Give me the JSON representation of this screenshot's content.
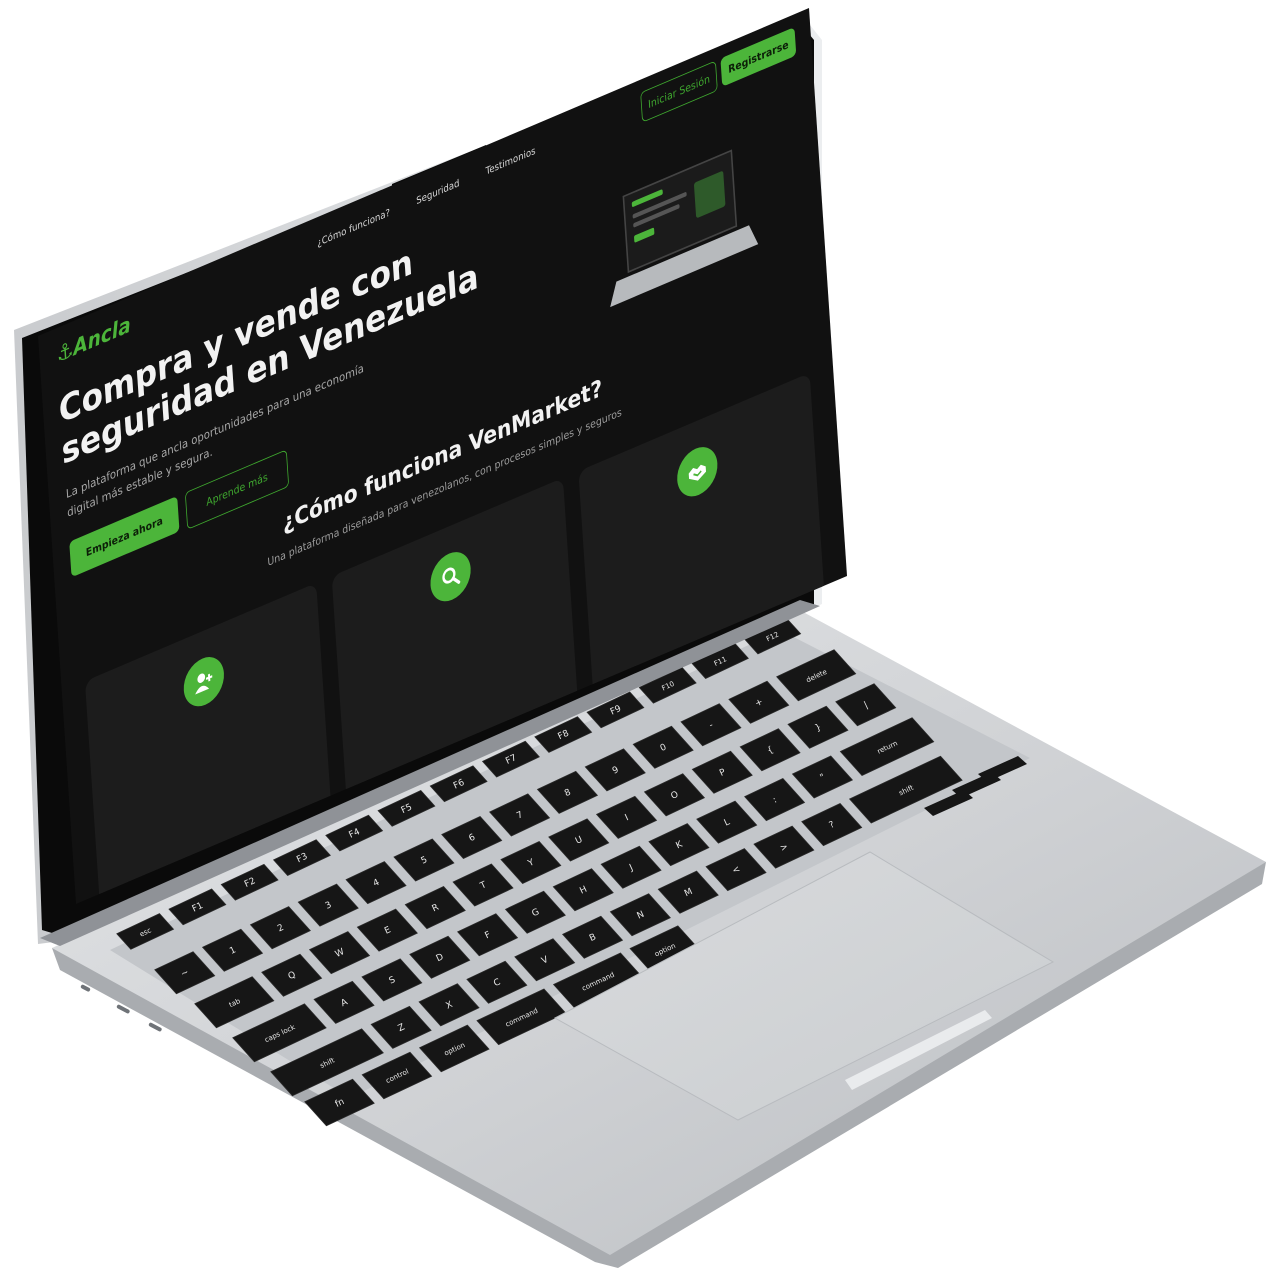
{
  "site": {
    "logo": "Ancla",
    "nav": [
      "¿Cómo funciona?",
      "Seguridad",
      "Testimonios"
    ],
    "login_label": "Iniciar Sesión",
    "register_label": "Registrarse"
  },
  "hero": {
    "title_lines": [
      "Compra y vende con",
      "seguridad en Venezuela"
    ],
    "subtitle_lines": [
      "La plataforma que ancla oportunidades para una economía",
      "digital más estable y segura."
    ],
    "primary_cta": "Empieza ahora",
    "secondary_cta": "Aprende más"
  },
  "how_it_works": {
    "title": "¿Cómo funciona VenMarket?",
    "subtitle": "Una plataforma diseñada para venezolanos, con procesos simples y seguros",
    "cards": [
      {
        "icon": "add-user-icon"
      },
      {
        "icon": "search-icon"
      },
      {
        "icon": "handshake-icon"
      }
    ]
  },
  "colors": {
    "accent": "#4cb53a",
    "screen_bg": "#111111",
    "card_bg": "#1c1c1c",
    "aluminum": "#d4d6d9",
    "key": "#161616"
  },
  "keyboard": {
    "function_row": [
      "esc",
      "F1",
      "F2",
      "F3",
      "F4",
      "F5",
      "F6",
      "F7",
      "F8",
      "F9",
      "F10",
      "F11",
      "F12"
    ],
    "number_row": [
      "~",
      "1",
      "2",
      "3",
      "4",
      "5",
      "6",
      "7",
      "8",
      "9",
      "0",
      "-",
      "+",
      "delete"
    ],
    "top_row": [
      "tab",
      "Q",
      "W",
      "E",
      "R",
      "T",
      "Y",
      "U",
      "I",
      "O",
      "P",
      "{",
      "}",
      "|"
    ],
    "home_row": [
      "caps lock",
      "A",
      "S",
      "D",
      "F",
      "G",
      "H",
      "J",
      "K",
      "L",
      ":",
      "\"",
      "return"
    ],
    "bottom_row": [
      "shift",
      "Z",
      "X",
      "C",
      "V",
      "B",
      "N",
      "M",
      "<",
      ">",
      "?",
      "shift"
    ],
    "modifier_row": [
      "fn",
      "control",
      "option",
      "command",
      "command",
      "option"
    ]
  }
}
